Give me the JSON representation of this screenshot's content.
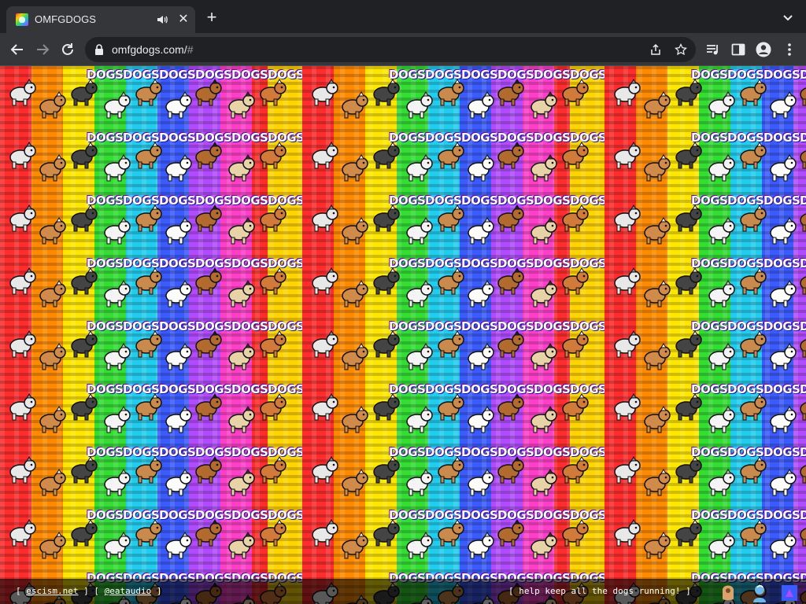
{
  "browser": {
    "tab": {
      "title": "OMFGDOGS",
      "favicon": "dog-favicon",
      "audio_icon": "speaker-icon",
      "close_icon": "close-icon"
    },
    "new_tab_icon": "plus-icon",
    "tab_search_icon": "chevron-down-icon",
    "nav": {
      "back_icon": "back-arrow-icon",
      "forward_icon": "forward-arrow-icon",
      "reload_icon": "reload-icon"
    },
    "address": {
      "host": "omfgdogs.com/",
      "fragment": "#",
      "lock_icon": "lock-icon"
    },
    "omnibox_icons": [
      "share-icon",
      "star-icon"
    ],
    "toolbar_icons": [
      "media-control-icon",
      "side-panel-icon",
      "profile-icon",
      "more-vert-icon"
    ]
  },
  "page": {
    "tile_word": "DOGS",
    "colors": {
      "red": "#ff2d2d",
      "orange": "#ff8a00",
      "yellow": "#ffe600",
      "green": "#33dd33",
      "cyan": "#22ccee",
      "blue": "#3b5bff",
      "purple": "#b24bff",
      "pink": "#ff3fc8"
    },
    "footer": {
      "open_bracket": "[ ",
      "link1": "escism.net",
      "sep": " ] [ ",
      "link2": "@eataudio",
      "close_bracket": " ]",
      "right_text": "[ help keep all the dogs running! ]",
      "icons": [
        "tip-jar-icon",
        "buy-icon",
        "share-page-icon"
      ]
    }
  }
}
